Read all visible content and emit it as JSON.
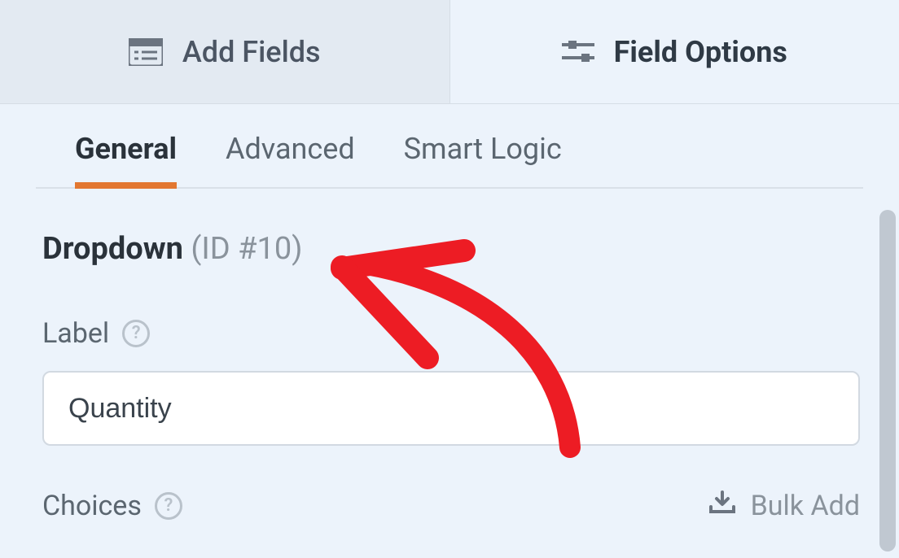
{
  "topbar": {
    "add_fields_label": "Add Fields",
    "field_options_label": "Field Options"
  },
  "subtabs": {
    "general": "General",
    "advanced": "Advanced",
    "smart_logic": "Smart Logic"
  },
  "field": {
    "type_label": "Dropdown",
    "id_label": "(ID #10)"
  },
  "label_section": {
    "title": "Label",
    "value": "Quantity"
  },
  "choices_section": {
    "title": "Choices",
    "bulk_add": "Bulk Add"
  },
  "help_glyph": "?",
  "colors": {
    "accent": "#e27730"
  }
}
